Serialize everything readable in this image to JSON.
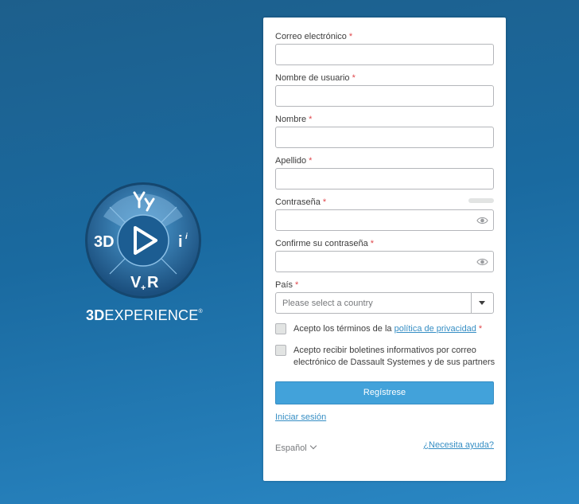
{
  "brand": {
    "prefix": "3D",
    "suffix": "EXPERIENCE",
    "mark": "®"
  },
  "logo": {
    "left": "3D",
    "right": "i",
    "bottom": "V+R",
    "top": "people"
  },
  "form": {
    "email_label": "Correo electrónico",
    "username_label": "Nombre de usuario",
    "firstname_label": "Nombre",
    "lastname_label": "Apellido",
    "password_label": "Contraseña",
    "confirm_label": "Confirme su contraseña",
    "country_label": "País",
    "country_placeholder": "Please select a country",
    "required_mark": "*",
    "terms_text": "Acepto los términos de la",
    "terms_link": "política de privacidad",
    "newsletter_text": "Acepto recibir boletines informativos por correo electrónico de Dassault Systemes y de sus partners",
    "submit_label": "Regístrese",
    "login_link": "Iniciar sesión",
    "language": "Español",
    "help_link": "¿Necesita ayuda?"
  },
  "colors": {
    "accent": "#42a2da",
    "link": "#368ec4",
    "required": "#e0474c",
    "background": "#1d5f8c"
  }
}
